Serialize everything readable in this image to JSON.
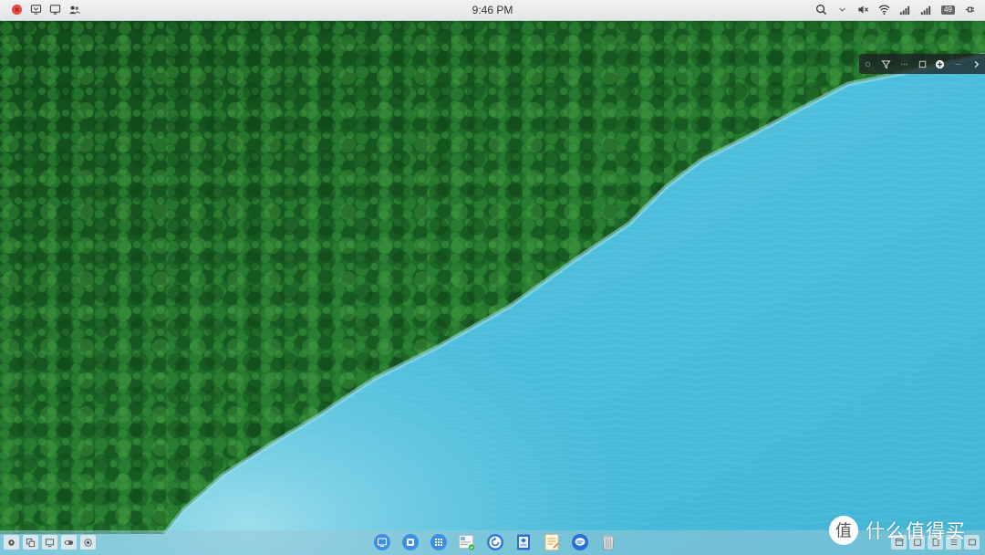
{
  "menubar": {
    "clock": "9:46 PM",
    "left_icons": [
      "close-circle-icon",
      "monitor-tray-icon",
      "display-icon",
      "users-icon"
    ],
    "right_icons": [
      "search-icon",
      "chevron-down-icon",
      "muted-speaker-icon",
      "wifi-icon",
      "signal-icon",
      "signal-icon-2"
    ],
    "battery": "49"
  },
  "floating_toolbar": {
    "icons": [
      "gear-icon",
      "filter-icon",
      "dots-icon",
      "square-icon",
      "add-circle-icon",
      "dash-icon",
      "chevron-right-icon"
    ]
  },
  "dock": {
    "left_icons": [
      "gear-icon",
      "copy-icon",
      "monitor-icon",
      "toggle-icon",
      "record-icon"
    ],
    "apps": [
      {
        "name": "Finder",
        "icon": "finder-icon"
      },
      {
        "name": "Files",
        "icon": "files-icon"
      },
      {
        "name": "Launchpad",
        "icon": "apps-grid-icon"
      },
      {
        "name": "Photos",
        "icon": "photos-icon"
      },
      {
        "name": "Sync",
        "icon": "refresh-icon"
      },
      {
        "name": "Viewer",
        "icon": "document-viewer-icon"
      },
      {
        "name": "Notes",
        "icon": "notes-icon"
      },
      {
        "name": "Messages",
        "icon": "chat-icon"
      },
      {
        "name": "Trash",
        "icon": "trash-icon"
      }
    ],
    "right_icons": [
      "window-icon",
      "window-icon-2",
      "window-icon-3",
      "list-icon",
      "window-icon-4"
    ]
  },
  "watermark": {
    "logo_char": "值",
    "text": "什么值得买"
  },
  "colors": {
    "water": "#4fc3df",
    "forest": "#1f6b2a",
    "close_red": "#ec4c44",
    "dock_blue": "#4a9be5"
  }
}
